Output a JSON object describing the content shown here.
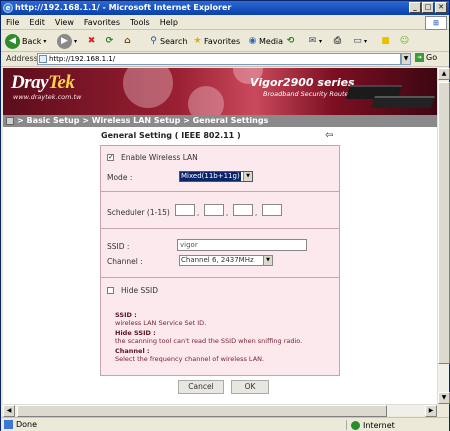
{
  "window": {
    "title": "http://192.168.1.1/ - Microsoft Internet Explorer",
    "min": "_",
    "max": "□",
    "close": "✕"
  },
  "menu": [
    "File",
    "Edit",
    "View",
    "Favorites",
    "Tools",
    "Help"
  ],
  "toolbar": {
    "back": "Back",
    "search": "Search",
    "favorites": "Favorites",
    "media": "Media"
  },
  "address": {
    "label": "Address",
    "url": "http://192.168.1.1/",
    "go": "Go"
  },
  "banner": {
    "brand_dray": "Dray",
    "brand_tek": "Tek",
    "brand_url": "www.draytek.com.tw",
    "product": "Vigor2900 series",
    "product_sub": "Broadband Security Router"
  },
  "breadcrumb": "> Basic Setup > Wireless LAN Setup > General Settings",
  "page_title": "General Setting ( IEEE 802.11 )",
  "back_arrow": "⇦",
  "form": {
    "enable_wireless": {
      "label": "Enable Wireless LAN",
      "checked": true
    },
    "mode": {
      "label": "Mode :",
      "value": "Mixed(11b+11g)"
    },
    "scheduler": {
      "label": "Scheduler (1-15)",
      "values": [
        "",
        "",
        "",
        ""
      ],
      "dot": ","
    },
    "ssid": {
      "label": "SSID :",
      "value": "vigor"
    },
    "channel": {
      "label": "Channel :",
      "value": "Channel 6, 2437MHz"
    },
    "hide_ssid": {
      "label": "Hide SSID",
      "checked": false
    }
  },
  "notes": [
    {
      "term": "SSID :",
      "desc": "wireless LAN Service Set ID."
    },
    {
      "term": "Hide SSID :",
      "desc": "the scanning tool can't read the SSID when sniffing radio."
    },
    {
      "term": "Channel :",
      "desc": "Select the frequency channel of wireless LAN."
    }
  ],
  "buttons": {
    "cancel": "Cancel",
    "ok": "OK"
  },
  "status": {
    "text": "Done",
    "zone": "Internet"
  },
  "colors": {
    "panel_bg": "#fbe9ed",
    "note_text": "#7a2230",
    "banner": "#9a1f32"
  }
}
